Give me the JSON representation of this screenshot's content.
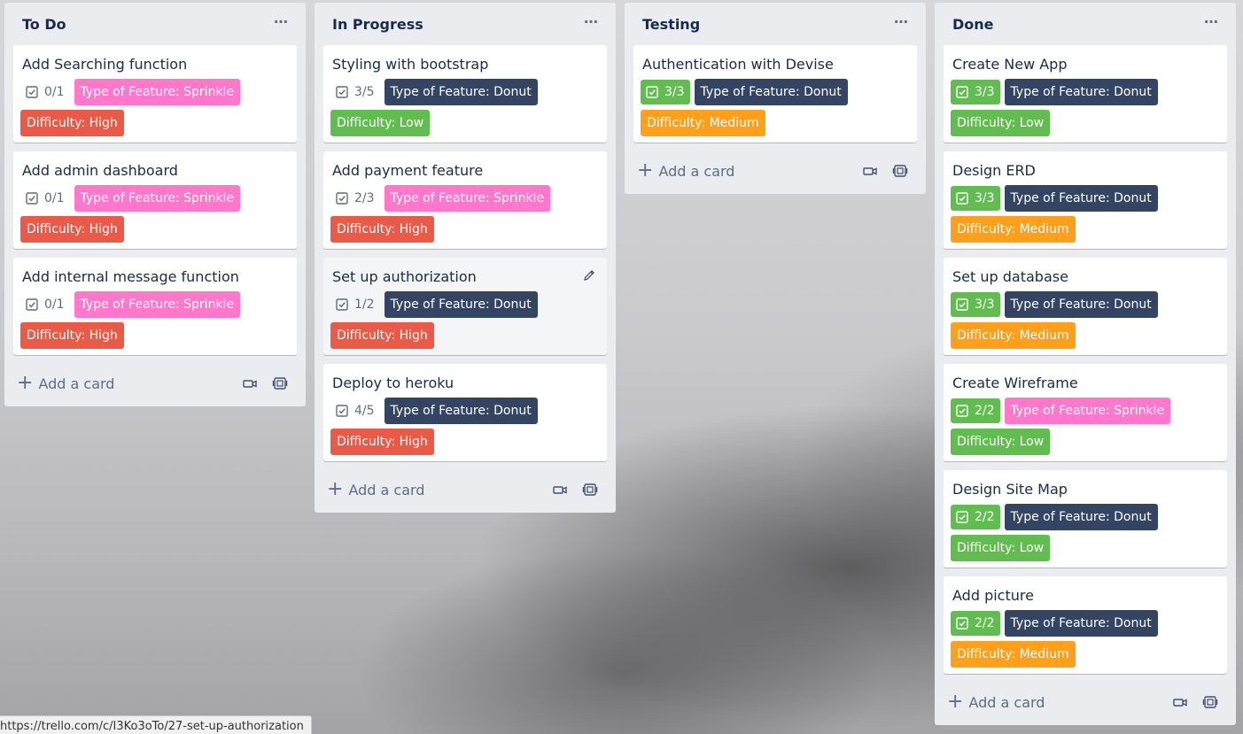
{
  "colors": {
    "sprinkle": "#ff78cb",
    "donut": "#344563",
    "high": "#eb5a46",
    "low": "#61bd4f",
    "medium": "#ff9f1a",
    "complete": "#61bd4f"
  },
  "add_card_label": "Add a card",
  "status_url": "https://trello.com/c/I3Ko3oTo/27-set-up-authorization",
  "lists": [
    {
      "title": "To Do",
      "cards": [
        {
          "title": "Add Searching function",
          "checklist": "0/1",
          "complete": false,
          "feature": "Type of Feature: Sprinkle",
          "feature_type": "sprinkle",
          "difficulty": "Difficulty: High",
          "difficulty_type": "high"
        },
        {
          "title": "Add admin dashboard",
          "checklist": "0/1",
          "complete": false,
          "feature": "Type of Feature: Sprinkle",
          "feature_type": "sprinkle",
          "difficulty": "Difficulty: High",
          "difficulty_type": "high"
        },
        {
          "title": "Add internal message function",
          "checklist": "0/1",
          "complete": false,
          "feature": "Type of Feature: Sprinkle",
          "feature_type": "sprinkle",
          "difficulty": "Difficulty: High",
          "difficulty_type": "high"
        }
      ]
    },
    {
      "title": "In Progress",
      "cards": [
        {
          "title": "Styling with bootstrap",
          "checklist": "3/5",
          "complete": false,
          "feature": "Type of Feature: Donut",
          "feature_type": "donut",
          "difficulty": "Difficulty: Low",
          "difficulty_type": "low"
        },
        {
          "title": "Add payment feature",
          "checklist": "2/3",
          "complete": false,
          "feature": "Type of Feature: Sprinkle",
          "feature_type": "sprinkle",
          "difficulty": "Difficulty: High",
          "difficulty_type": "high"
        },
        {
          "title": "Set up authorization",
          "checklist": "1/2",
          "complete": false,
          "feature": "Type of Feature: Donut",
          "feature_type": "donut",
          "difficulty": "Difficulty: High",
          "difficulty_type": "high",
          "hovered": true
        },
        {
          "title": "Deploy to heroku",
          "checklist": "4/5",
          "complete": false,
          "feature": "Type of Feature: Donut",
          "feature_type": "donut",
          "difficulty": "Difficulty: High",
          "difficulty_type": "high"
        }
      ]
    },
    {
      "title": "Testing",
      "cards": [
        {
          "title": "Authentication with Devise",
          "checklist": "3/3",
          "complete": true,
          "feature": "Type of Feature: Donut",
          "feature_type": "donut",
          "difficulty": "Difficulty: Medium",
          "difficulty_type": "medium"
        }
      ]
    },
    {
      "title": "Done",
      "cards": [
        {
          "title": "Create New App",
          "checklist": "3/3",
          "complete": true,
          "feature": "Type of Feature: Donut",
          "feature_type": "donut",
          "difficulty": "Difficulty: Low",
          "difficulty_type": "low"
        },
        {
          "title": "Design ERD",
          "checklist": "3/3",
          "complete": true,
          "feature": "Type of Feature: Donut",
          "feature_type": "donut",
          "difficulty": "Difficulty: Medium",
          "difficulty_type": "medium"
        },
        {
          "title": "Set up database",
          "checklist": "3/3",
          "complete": true,
          "feature": "Type of Feature: Donut",
          "feature_type": "donut",
          "difficulty": "Difficulty: Medium",
          "difficulty_type": "medium"
        },
        {
          "title": "Create Wireframe",
          "checklist": "2/2",
          "complete": true,
          "feature": "Type of Feature: Sprinkle",
          "feature_type": "sprinkle",
          "difficulty": "Difficulty: Low",
          "difficulty_type": "low"
        },
        {
          "title": "Design Site Map",
          "checklist": "2/2",
          "complete": true,
          "feature": "Type of Feature: Donut",
          "feature_type": "donut",
          "difficulty": "Difficulty: Low",
          "difficulty_type": "low"
        },
        {
          "title": "Add picture",
          "checklist": "2/2",
          "complete": true,
          "feature": "Type of Feature: Donut",
          "feature_type": "donut",
          "difficulty": "Difficulty: Medium",
          "difficulty_type": "medium"
        }
      ]
    }
  ]
}
